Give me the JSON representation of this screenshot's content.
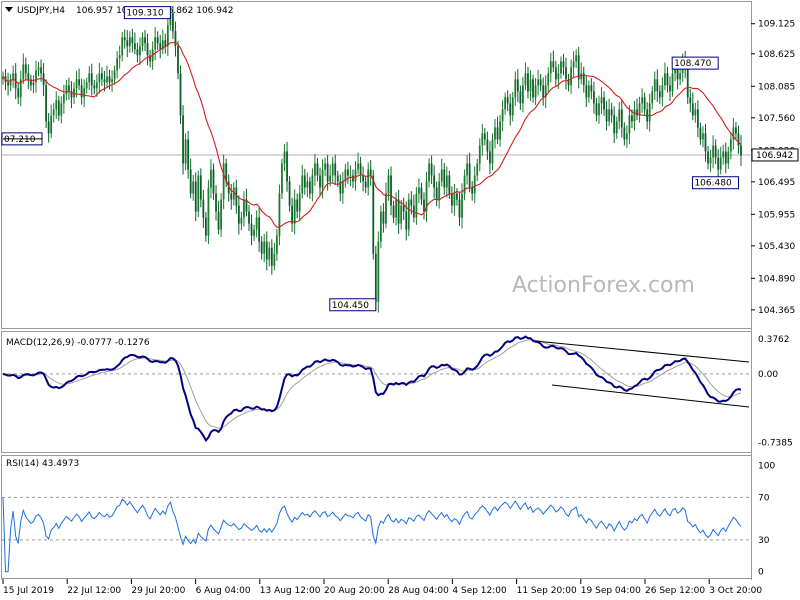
{
  "chart_data": {
    "type": "candlestick",
    "header": {
      "symbol": "USDJPY,H4",
      "ohlc": "106.957 106.979 106.862 106.942"
    },
    "watermark": "ActionForex.com",
    "price_panel": {
      "ylim": [
        104.08,
        109.47
      ],
      "y_ticks": [
        "109.125",
        "108.625",
        "108.085",
        "107.560",
        "107.020",
        "106.495",
        "105.955",
        "105.430",
        "104.890",
        "104.365"
      ],
      "current_price": "106.942",
      "price_labels": [
        {
          "text": "109.310",
          "value": 109.31,
          "anchor_bar": 66
        },
        {
          "text": "07.210",
          "value": 107.21,
          "anchor_bar": 0
        },
        {
          "text": "104.450",
          "value": 104.45,
          "anchor_bar": 147
        },
        {
          "text": "108.470",
          "value": 108.47,
          "anchor_bar": 282
        },
        {
          "text": "106.480",
          "value": 106.48,
          "anchor_bar": 290
        }
      ],
      "closes": [
        108.25,
        108.15,
        108.1,
        108.2,
        108.3,
        108.05,
        107.9,
        108.2,
        108.45,
        108.3,
        108.2,
        108.1,
        108.15,
        108.35,
        108.4,
        108.3,
        108.1,
        107.5,
        107.3,
        107.6,
        107.7,
        107.85,
        107.6,
        107.8,
        107.95,
        108.1,
        108.0,
        107.9,
        108.05,
        108.2,
        108.1,
        107.9,
        108.05,
        108.15,
        108.3,
        108.1,
        108.05,
        108.15,
        108.3,
        108.2,
        108.15,
        108.25,
        108.15,
        108.2,
        108.35,
        108.55,
        108.6,
        108.9,
        108.85,
        108.75,
        108.9,
        108.8,
        108.7,
        108.6,
        108.75,
        108.9,
        108.8,
        108.6,
        108.5,
        108.7,
        108.9,
        108.8,
        108.7,
        108.85,
        108.75,
        109.1,
        109.3,
        109.0,
        108.75,
        108.3,
        107.6,
        106.8,
        107.2,
        106.7,
        106.3,
        106.5,
        106.0,
        106.6,
        106.2,
        105.9,
        105.6,
        106.4,
        106.7,
        106.3,
        106.0,
        105.7,
        106.2,
        106.8,
        106.5,
        106.3,
        106.2,
        106.4,
        106.1,
        105.8,
        105.9,
        106.2,
        106.0,
        105.8,
        105.6,
        105.7,
        105.9,
        105.5,
        105.3,
        105.5,
        105.2,
        105.4,
        105.1,
        105.3,
        105.6,
        106.3,
        106.8,
        107.0,
        106.5,
        106.1,
        105.8,
        106.2,
        106.0,
        106.3,
        106.6,
        106.4,
        106.5,
        106.3,
        106.6,
        106.8,
        106.6,
        106.4,
        106.7,
        106.8,
        106.5,
        106.6,
        106.8,
        106.6,
        106.5,
        106.3,
        106.5,
        106.7,
        106.6,
        106.6,
        106.5,
        106.7,
        106.8,
        106.6,
        106.5,
        106.4,
        106.7,
        106.6,
        105.3,
        104.5,
        105.5,
        106.0,
        105.8,
        106.3,
        106.6,
        106.1,
        105.9,
        106.2,
        105.8,
        106.1,
        106.0,
        105.7,
        106.2,
        106.1,
        105.9,
        106.3,
        106.4,
        106.2,
        106.0,
        106.5,
        106.8,
        106.6,
        106.4,
        106.2,
        106.5,
        106.7,
        106.4,
        106.6,
        106.3,
        106.1,
        106.3,
        106.2,
        105.9,
        106.3,
        106.6,
        106.8,
        106.4,
        106.3,
        106.6,
        106.8,
        107.1,
        107.3,
        107.2,
        107.0,
        106.8,
        107.2,
        107.4,
        107.2,
        107.5,
        107.7,
        107.9,
        107.8,
        107.6,
        107.9,
        108.2,
        108.0,
        107.8,
        108.1,
        108.3,
        108.0,
        108.2,
        107.9,
        108.1,
        108.2,
        108.1,
        107.9,
        108.1,
        108.3,
        108.5,
        108.4,
        108.2,
        108.3,
        108.5,
        108.4,
        108.2,
        108.1,
        108.4,
        108.5,
        108.6,
        108.2,
        108.3,
        108.1,
        107.9,
        108.1,
        108.0,
        107.8,
        107.6,
        107.8,
        107.9,
        107.7,
        107.5,
        107.7,
        107.6,
        107.3,
        107.5,
        107.7,
        107.4,
        107.2,
        107.3,
        107.6,
        107.5,
        107.7,
        107.6,
        107.8,
        107.9,
        107.7,
        107.5,
        107.8,
        108.0,
        108.2,
        108.0,
        107.9,
        108.1,
        108.3,
        108.1,
        108.0,
        108.3,
        108.4,
        108.2,
        108.3,
        108.5,
        108.4,
        107.9,
        107.8,
        107.6,
        107.7,
        107.4,
        107.2,
        107.3,
        107.0,
        106.8,
        106.9,
        107.1,
        106.9,
        106.7,
        106.9,
        107.0,
        106.8,
        107.0,
        107.2,
        107.4,
        107.3,
        107.1,
        106.94
      ],
      "sma_period": 20
    },
    "macd_panel": {
      "label": "MACD(12,26,9) -0.0777 -0.1276",
      "ylim": [
        -0.83,
        0.44
      ],
      "y_ticks": [
        "0.3762",
        "0.00",
        "-0.7385"
      ],
      "zero_label": "0.00"
    },
    "rsi_panel": {
      "label": "RSI(14) 43.4973",
      "ylim": [
        -5,
        108
      ],
      "y_ticks": [
        "100",
        "70",
        "30",
        "0"
      ],
      "levels": [
        70,
        30
      ]
    },
    "x_axis": {
      "tick_labels": [
        "15 Jul 2019",
        "22 Jul 12:00",
        "29 Jul 20:00",
        "6 Aug 04:00",
        "13 Aug 12:00",
        "20 Aug 20:00",
        "28 Aug 04:00",
        "4 Sep 12:00",
        "11 Sep 20:00",
        "19 Sep 04:00",
        "26 Sep 12:00",
        "3 Oct 20:00"
      ]
    },
    "colors": {
      "up_candle": "#1e7a2e",
      "down_candle": "#0b5e2a",
      "sma": "#d11e1e",
      "macd_line": "#000080",
      "macd_signal": "#a0a0a0",
      "rsi_line": "#1e6fe0",
      "border": "#9a9a9a",
      "level_dash": "#9a9a9a"
    }
  }
}
